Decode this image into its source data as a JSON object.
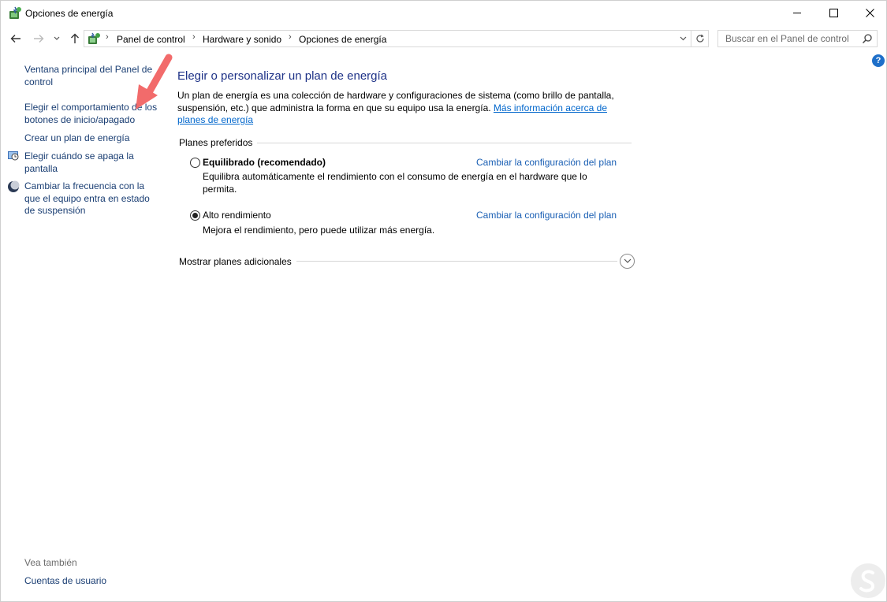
{
  "window": {
    "title": "Opciones de energía",
    "title_icon": "power-options-icon"
  },
  "address": {
    "breadcrumbs": [
      "Panel de control",
      "Hardware y sonido",
      "Opciones de energía"
    ],
    "search_placeholder": "Buscar en el Panel de control"
  },
  "left_pane": {
    "links": [
      "Ventana principal del Panel de control",
      "Elegir el comportamiento de los botones de inicio/apagado",
      "Crear un plan de energía",
      "Elegir cuándo se apaga la pantalla",
      "Cambiar la frecuencia con la que el equipo entra en estado de suspensión"
    ],
    "see_also_label": "Vea también",
    "see_also_links": [
      "Cuentas de usuario"
    ]
  },
  "main": {
    "title": "Elegir o personalizar un plan de energía",
    "intro_text": "Un plan de energía es una colección de hardware y configuraciones de sistema (como brillo de pantalla, suspensión, etc.) que administra la forma en que su equipo usa la energía.",
    "intro_link": "Más información acerca de planes de energía",
    "preferred_label": "Planes preferidos",
    "plans": [
      {
        "name": "Equilibrado (recomendado)",
        "description": "Equilibra automáticamente el rendimiento con el consumo de energía en el hardware que lo permita.",
        "change_link": "Cambiar la configuración del plan",
        "selected": false
      },
      {
        "name": "Alto rendimiento",
        "description": "Mejora el rendimiento, pero puede utilizar más energía.",
        "change_link": "Cambiar la configuración del plan",
        "selected": true
      }
    ],
    "more_plans_label": "Mostrar planes adicionales"
  },
  "help_label": "?",
  "colors": {
    "link": "#1a3e73",
    "heading": "#1e3287",
    "hyperlink": "#0066cc",
    "arrow": "#f26b6b"
  }
}
